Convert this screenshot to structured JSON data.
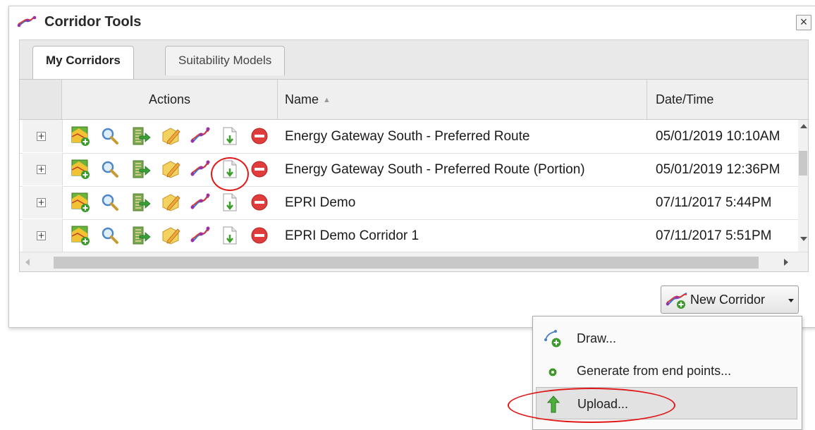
{
  "window": {
    "title": "Corridor Tools",
    "close_glyph": "×",
    "title_icon": "corridor-icon"
  },
  "tabs": [
    {
      "label": "My Corridors",
      "active": true
    },
    {
      "label": "Suitability Models",
      "active": false
    }
  ],
  "grid": {
    "columns": [
      "Actions",
      "Name",
      "Date/Time"
    ],
    "sort": {
      "column": "Name",
      "direction": "ascending"
    },
    "action_icons": [
      "map-add-icon",
      "zoom-icon",
      "export-icon",
      "edit-icon",
      "corridor-icon",
      "download-icon",
      "delete-icon"
    ],
    "rows": [
      {
        "name": "Energy Gateway South - Preferred Route",
        "datetime": "05/01/2019 10:10AM"
      },
      {
        "name": "Energy Gateway South - Preferred Route (Portion)",
        "datetime": "05/01/2019 12:36PM"
      },
      {
        "name": "EPRI Demo",
        "datetime": "07/11/2017 5:44PM"
      },
      {
        "name": "EPRI Demo Corridor 1",
        "datetime": "07/11/2017 5:51PM"
      }
    ],
    "expander_glyph": "+"
  },
  "new_corridor": {
    "label": "New Corridor"
  },
  "menu": {
    "items": [
      {
        "label": "Draw...",
        "icon": "draw-corridor-icon"
      },
      {
        "label": "Generate from end points...",
        "icon": "endpoints-icon"
      },
      {
        "label": "Upload...",
        "icon": "upload-arrow-icon",
        "highlighted": true
      }
    ]
  },
  "colors": {
    "highlight_circle": "#e01818",
    "delete": "#e03c3c",
    "grid_header": "#efefef"
  }
}
